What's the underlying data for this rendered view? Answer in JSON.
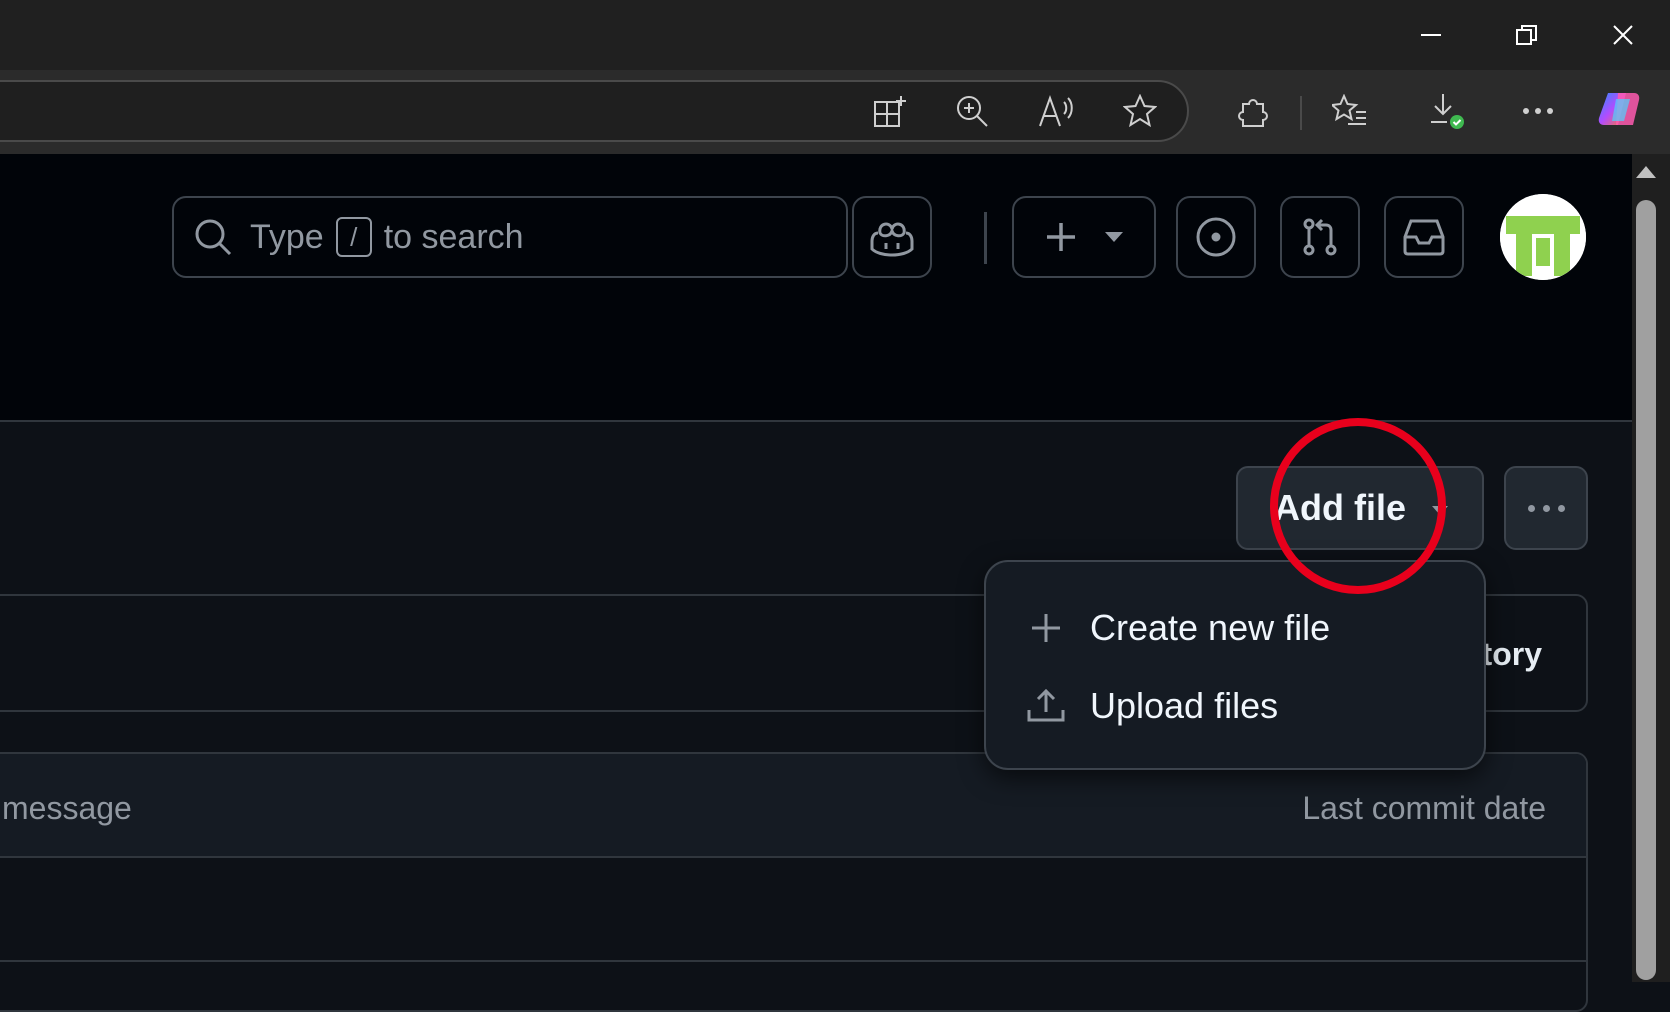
{
  "search": {
    "prefix": "Type",
    "key": "/",
    "suffix": "to search"
  },
  "repo": {
    "add_file_label": "Add file",
    "partial_button_label": "tory"
  },
  "table": {
    "col_message": "message",
    "col_date": "Last commit date"
  },
  "add_file_menu": {
    "items": [
      {
        "label": "Create new file",
        "icon": "plus-icon"
      },
      {
        "label": "Upload files",
        "icon": "upload-icon"
      }
    ]
  },
  "colors": {
    "annotation": "#e8001c",
    "page_bg": "#0d1117",
    "header_bg": "#010409"
  }
}
